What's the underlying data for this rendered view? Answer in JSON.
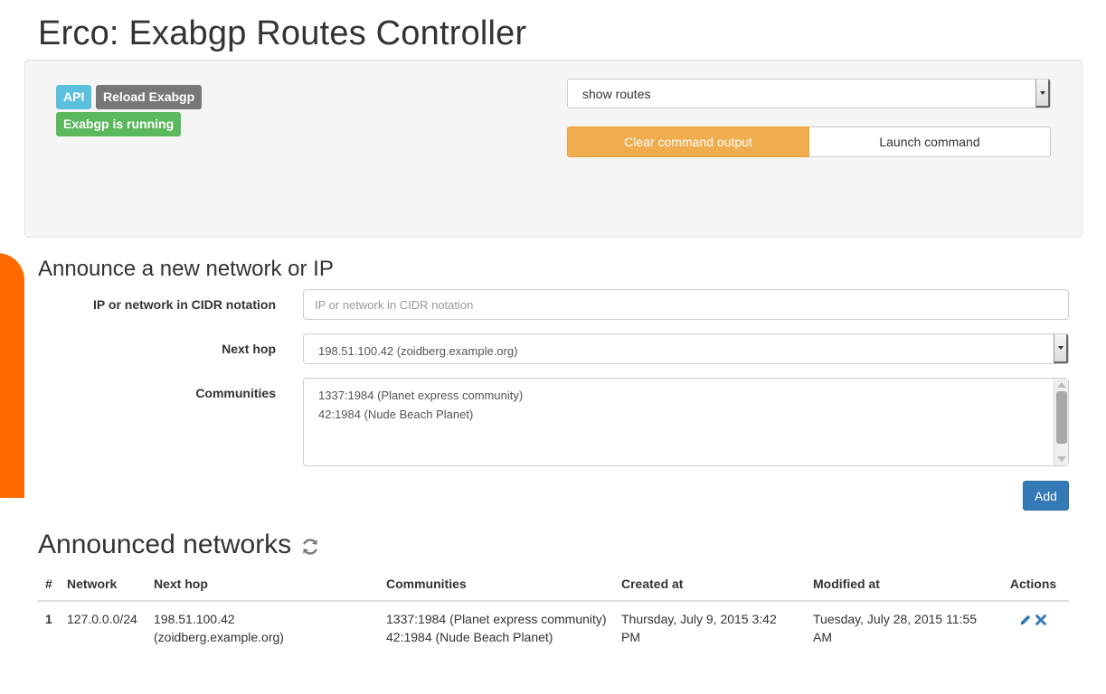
{
  "page": {
    "title": "Erco: Exabgp Routes Controller"
  },
  "toolbar": {
    "api_label": "API",
    "reload_label": "Reload Exabgp",
    "status_label": "Exabgp is running",
    "command_select_value": "show routes",
    "clear_button": "Clear command output",
    "launch_button": "Launch command"
  },
  "announce": {
    "title": "Announce a new network or IP",
    "ip_label": "IP or network in CIDR notation",
    "ip_placeholder": "IP or network in CIDR notation",
    "next_hop_label": "Next hop",
    "next_hop_value": "198.51.100.42 (zoidberg.example.org)",
    "communities_label": "Communities",
    "communities_options": [
      "1337:1984 (Planet express community)",
      "42:1984 (Nude Beach Planet)"
    ],
    "add_button": "Add"
  },
  "networks": {
    "title": "Announced networks",
    "columns": [
      "#",
      "Network",
      "Next hop",
      "Communities",
      "Created at",
      "Modified at",
      "Actions"
    ],
    "rows": [
      {
        "num": "1",
        "network": "127.0.0.0/24",
        "next_hop_ip": "198.51.100.42",
        "next_hop_host": "(zoidberg.example.org)",
        "communities_1": "1337:1984 (Planet express community)",
        "communities_2": "42:1984 (Nude Beach Planet)",
        "created_at": "Thursday, July 9, 2015 3:42 PM",
        "modified_at": "Tuesday, July 28, 2015 11:55 AM"
      }
    ]
  },
  "colors": {
    "info": "#5bc0de",
    "default": "#777777",
    "success": "#5cb85c",
    "warning": "#f0ad4e",
    "primary": "#337ab7",
    "accent_tab": "#ff6a00"
  },
  "icons": [
    "refresh-icon",
    "edit-icon",
    "delete-icon"
  ]
}
